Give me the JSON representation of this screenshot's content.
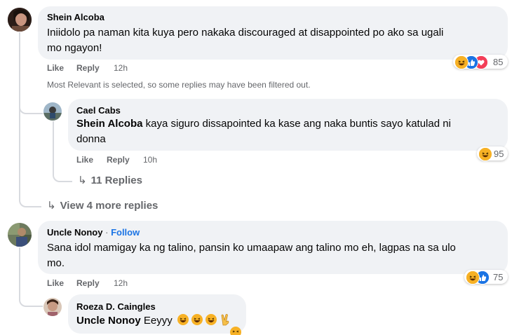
{
  "comments": [
    {
      "author": "Shein Alcoba",
      "text_line1": "Iniidolo pa naman kita kuya pero nakaka discouraged at disappointed po ako sa ugali",
      "text_line2": "mo ngayon!",
      "like": "Like",
      "reply": "Reply",
      "time": "12h",
      "reaction_count": "85",
      "reactions": [
        "haha-icon",
        "like-icon",
        "love-icon"
      ]
    },
    {
      "author": "Uncle Nonoy",
      "follow": "Follow",
      "separator": "·",
      "text_line1": "Sana idol mamigay ka ng talino, pansin ko umaapaw ang talino mo eh, lagpas na sa ulo",
      "text_line2": "mo.",
      "like": "Like",
      "reply": "Reply",
      "time": "12h",
      "reaction_count": "75",
      "reactions": [
        "haha-icon",
        "like-icon"
      ]
    }
  ],
  "filter_note": "Most Relevant is selected, so some replies may have been filtered out.",
  "replies": [
    {
      "author": "Cael Cabs",
      "mention": "Shein Alcoba",
      "text_line1": " kaya siguro dissapointed ka kase ang naka buntis sayo katulad ni",
      "text_line2": "donna",
      "like": "Like",
      "reply": "Reply",
      "time": "10h",
      "reaction_count": "95",
      "nested_replies": "11 Replies"
    },
    {
      "author": "Roeza D. Caingles",
      "mention": "Uncle Nonoy",
      "text": " Eeyyy"
    }
  ],
  "view_more": "View 4 more replies",
  "colors": {
    "bubble": "#f0f2f5",
    "secondary_text": "#65676b",
    "follow_blue": "#1b74e4",
    "like_blue": "#1b74e4",
    "love_red": "#f33e58",
    "haha_yellow": "#f7b125"
  }
}
